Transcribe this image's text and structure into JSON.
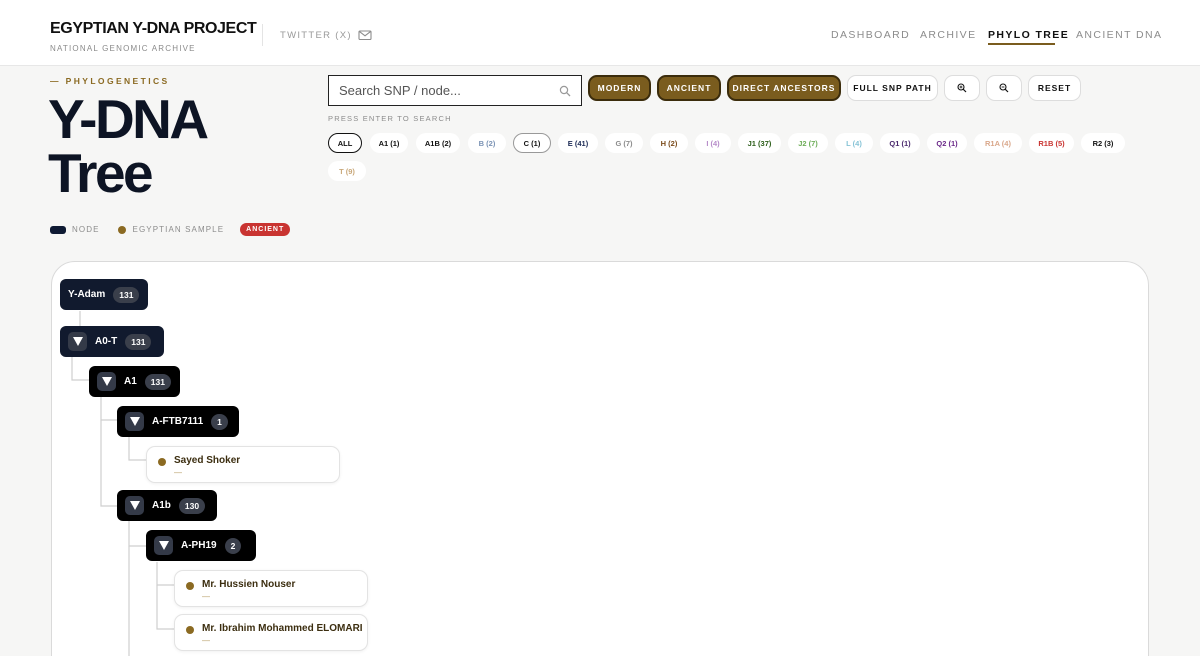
{
  "header": {
    "title": "EGYPTIAN Y-DNA PROJECT",
    "subtitle": "NATIONAL GENOMIC ARCHIVE",
    "twitter_label": "TWITTER (X)",
    "mail_icon": "mail-icon",
    "nav": [
      {
        "label": "DASHBOARD",
        "active": false
      },
      {
        "label": "ARCHIVE",
        "active": false
      },
      {
        "label": "PHYLO TREE",
        "active": true
      },
      {
        "label": "ANCIENT DNA",
        "active": false
      }
    ]
  },
  "hero": {
    "eyebrow": "— PHYLOGENETICS",
    "title_line1": "Y-DNA",
    "title_line2": "Tree"
  },
  "legend": {
    "node": "NODE",
    "sample": "EGYPTIAN SAMPLE",
    "ancient": "ANCIENT"
  },
  "search": {
    "placeholder": "Search SNP / node...",
    "value": "",
    "hint": "PRESS ENTER TO SEARCH",
    "icon": "search-icon"
  },
  "buttons": {
    "modern": "MODERN",
    "ancient": "ANCIENT",
    "direct_ancestors": "DIRECT ANCESTORS",
    "full_snp_path": "FULL SNP PATH",
    "zoom_in_icon": "zoom-in-icon",
    "zoom_out_icon": "zoom-out-icon",
    "reset": "RESET"
  },
  "filters": [
    {
      "label": "ALL",
      "color": "#111111"
    },
    {
      "label": "A1 (1)",
      "color": "#111111"
    },
    {
      "label": "A1B (2)",
      "color": "#111111"
    },
    {
      "label": "B (2)",
      "color": "#7b93b5"
    },
    {
      "label": "C (1)",
      "color": "#111111"
    },
    {
      "label": "E (41)",
      "color": "#1b2a55"
    },
    {
      "label": "G (7)",
      "color": "#8c8c8c"
    },
    {
      "label": "H (2)",
      "color": "#7a4a1a"
    },
    {
      "label": "I (4)",
      "color": "#b68bc9"
    },
    {
      "label": "J1 (37)",
      "color": "#2c5e1a"
    },
    {
      "label": "J2 (7)",
      "color": "#6fae5a"
    },
    {
      "label": "L (4)",
      "color": "#86c3d6"
    },
    {
      "label": "Q1 (1)",
      "color": "#4b2a6e"
    },
    {
      "label": "Q2 (1)",
      "color": "#6c2a8a"
    },
    {
      "label": "R1A (4)",
      "color": "#d9a78a"
    },
    {
      "label": "R1B (5)",
      "color": "#c93431"
    },
    {
      "label": "R2 (3)",
      "color": "#111111"
    },
    {
      "label": "T (9)",
      "color": "#c9a87a"
    }
  ],
  "tree": {
    "nodes": [
      {
        "label": "Y-Adam",
        "count": "131"
      },
      {
        "label": "A0-T",
        "count": "131"
      },
      {
        "label": "A1",
        "count": "131"
      },
      {
        "label": "A-FTB7111",
        "count": "1"
      },
      {
        "label": "A1b",
        "count": "130"
      },
      {
        "label": "A-PH19",
        "count": "2"
      }
    ],
    "samples": [
      {
        "name": "Sayed Shoker",
        "detail": "—"
      },
      {
        "name": "Mr. Hussien Nouser",
        "detail": "—"
      },
      {
        "name": "Mr. Ibrahim Mohammed ELOMARI",
        "detail": "—"
      }
    ]
  },
  "colors": {
    "accent_gold": "#7a5c1e",
    "node_dark": "#111a2e",
    "ancient_red": "#c93431"
  }
}
